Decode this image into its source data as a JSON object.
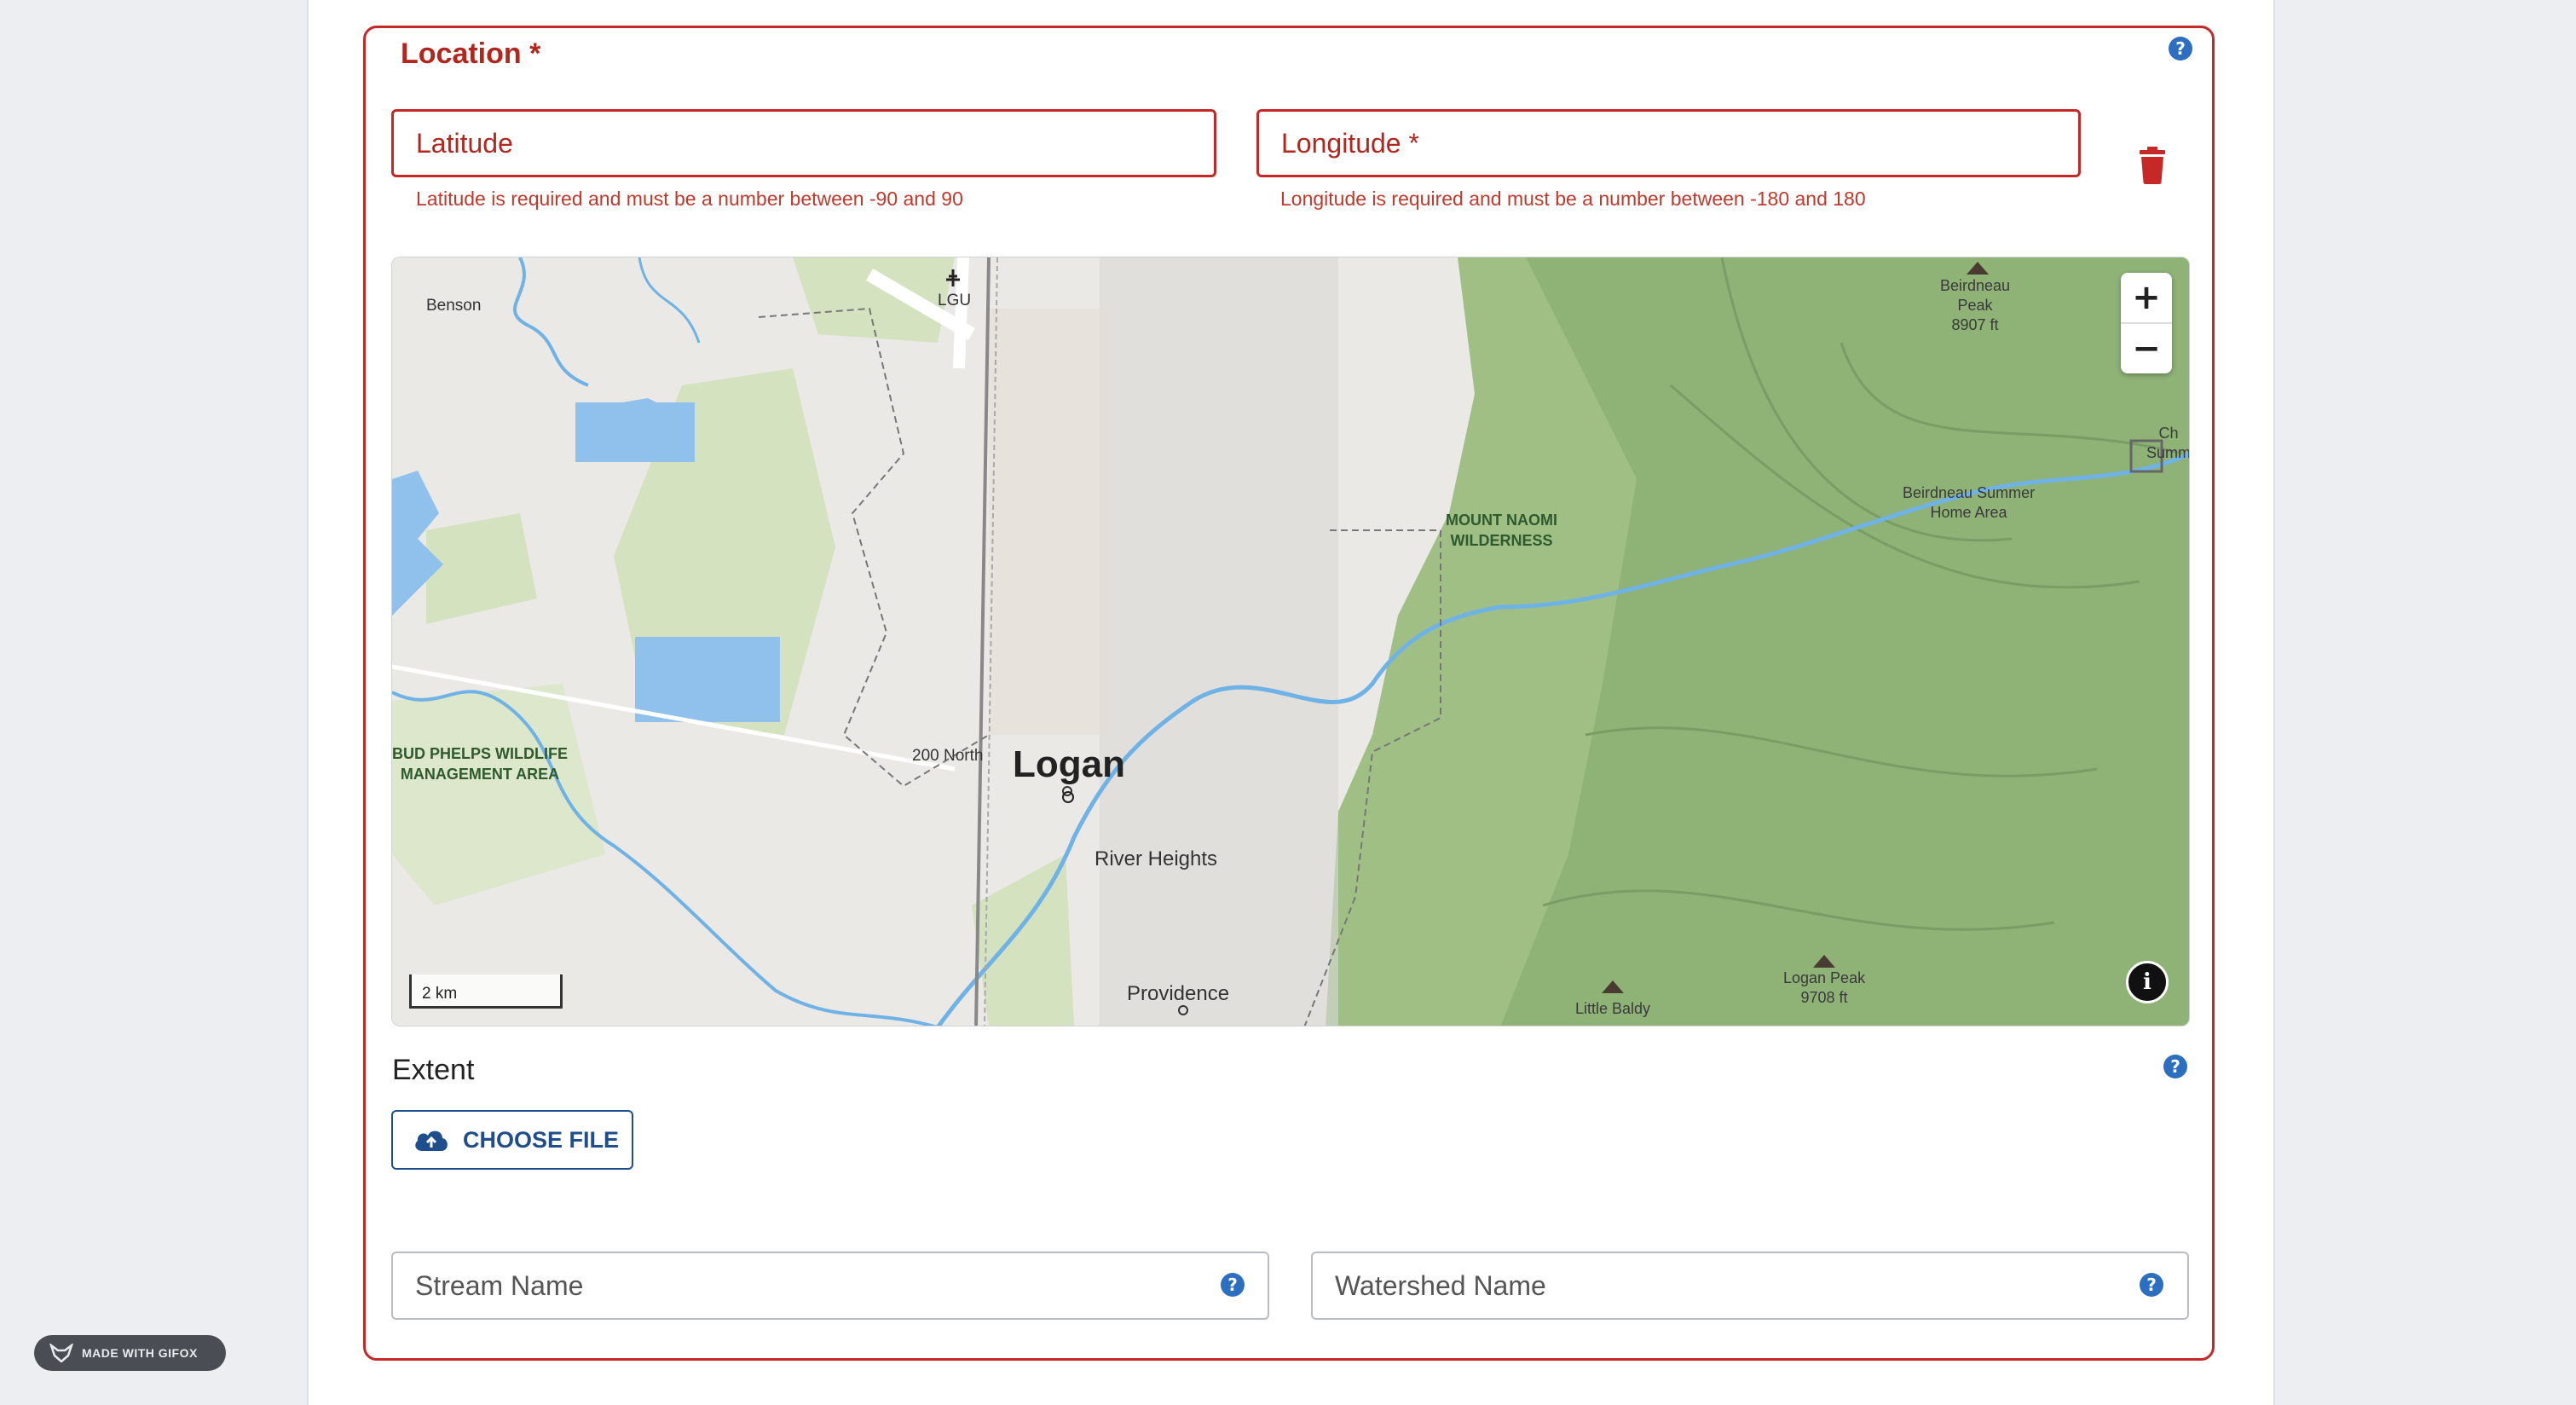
{
  "location": {
    "title": "Location *",
    "latitude": {
      "placeholder": "Latitude",
      "error": "Latitude is required and must be a number between -90 and 90"
    },
    "longitude": {
      "placeholder": "Longitude *",
      "error": "Longitude is required and must be a number between -180 and 180"
    }
  },
  "map": {
    "labels": {
      "benson": "Benson",
      "lgu": "LGU",
      "beirdneau_peak": "Beirdneau\nPeak\n8907 ft",
      "ch_summ": "Ch\nSumm",
      "beirdneau_summer": "Beirdneau Summer\nHome Area",
      "mount_naomi": "MOUNT NAOMI\nWILDERNESS",
      "bud_phelps": "BUD PHELPS WILDLIFE\nMANAGEMENT AREA",
      "north_200": "200 North",
      "logan": "Logan",
      "river_heights": "River Heights",
      "providence": "Providence",
      "little_baldy": "Little Baldy",
      "logan_peak": "Logan Peak\n9708 ft"
    },
    "scale": "2 km",
    "zoom_in": "+",
    "zoom_out": "−",
    "info": "i"
  },
  "extent": {
    "label": "Extent",
    "choose_file": "CHOOSE FILE"
  },
  "stream_name": {
    "placeholder": "Stream Name"
  },
  "watershed_name": {
    "placeholder": "Watershed Name"
  },
  "help_glyph": "?",
  "watermark": "MADE WITH GIFOX",
  "colors": {
    "error": "#c62828",
    "primary": "#1f4e8c",
    "help": "#2c6fc1"
  }
}
